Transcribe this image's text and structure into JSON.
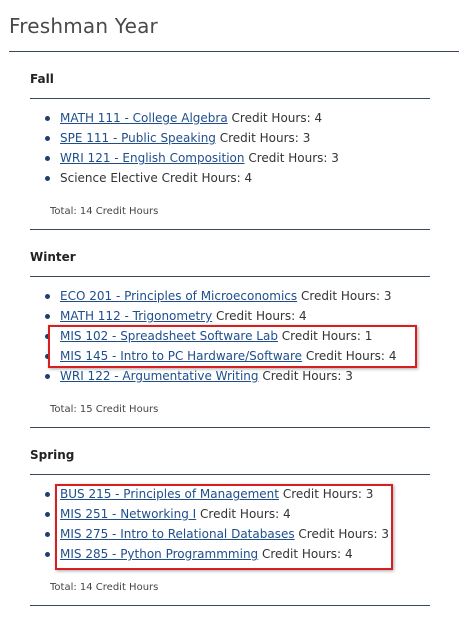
{
  "page_title": "Freshman Year",
  "credit_hours_label": "Credit Hours:",
  "terms": [
    {
      "name": "Fall",
      "courses": [
        {
          "link": "MATH 111 - College Algebra",
          "text": "",
          "hours": "4"
        },
        {
          "link": "SPE 111 - Public Speaking",
          "text": "",
          "hours": "3"
        },
        {
          "link": "WRI 121 - English Composition",
          "text": "",
          "hours": "3"
        },
        {
          "link": "",
          "text": "Science Elective",
          "hours": "4"
        }
      ],
      "total": "Total: 14 Credit Hours"
    },
    {
      "name": "Winter",
      "courses": [
        {
          "link": "ECO 201 - Principles of Microeconomics",
          "text": "",
          "hours": "3"
        },
        {
          "link": "MATH 112 - Trigonometry",
          "text": "",
          "hours": "4"
        },
        {
          "link": "MIS 102 - Spreadsheet Software Lab",
          "text": "",
          "hours": "1"
        },
        {
          "link": "MIS 145 - Intro to PC Hardware/Software",
          "text": "",
          "hours": "4"
        },
        {
          "link": "WRI 122 - Argumentative Writing",
          "text": "",
          "hours": "3"
        }
      ],
      "total": "Total: 15 Credit Hours"
    },
    {
      "name": "Spring",
      "courses": [
        {
          "link": "BUS 215 - Principles of Management",
          "text": "",
          "hours": "3"
        },
        {
          "link": "MIS 251 - Networking I",
          "text": "",
          "hours": "4"
        },
        {
          "link": "MIS 275 - Intro to Relational Databases",
          "text": "",
          "hours": "3"
        },
        {
          "link": "MIS 285 - Python Programmming",
          "text": "",
          "hours": "4"
        }
      ],
      "total": "Total: 14 Credit Hours"
    }
  ],
  "colors": {
    "link": "#1f4e8c",
    "rule": "#3a4a5c",
    "highlight": "#d81e1e"
  }
}
